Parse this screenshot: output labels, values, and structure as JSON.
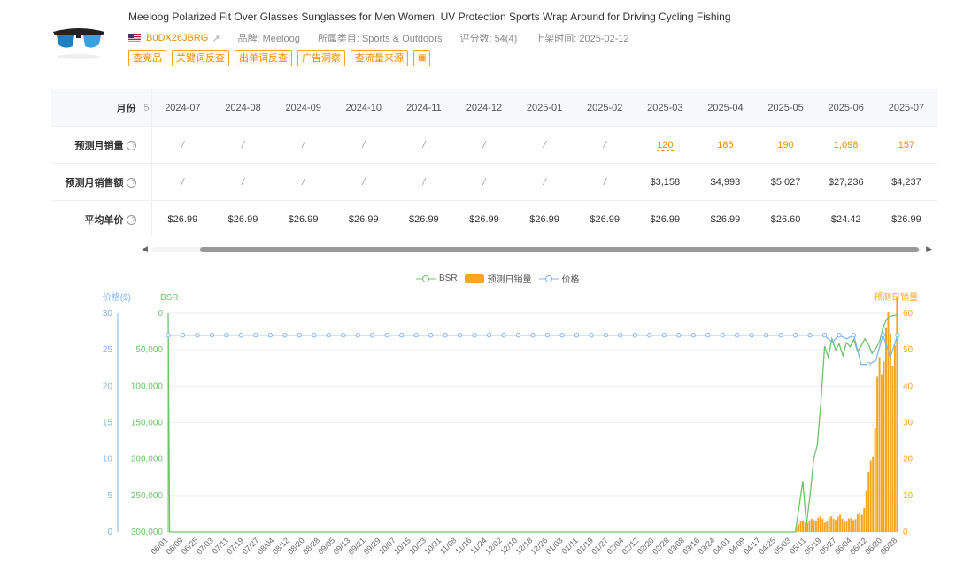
{
  "product": {
    "title": "Meeloog Polarized Fit Over Glasses Sunglasses for Men Women, UV Protection Sports Wrap Around for Driving Cycling Fishing",
    "asin": "B0DX26JBRG",
    "brand": "品牌: Meeloog",
    "category": "所属类目: Sports & Outdoors",
    "rating_count": "评分数: 54(4)",
    "launch_date": "上架时间: 2025-02-12",
    "flag_icon": "us-flag-icon",
    "link_icon": "external-link-icon"
  },
  "tags": [
    "查竞品",
    "关键词反查",
    "出单词反查",
    "广告洞察",
    "查流量来源"
  ],
  "table": {
    "row_month_label": "月份",
    "partial_sep": "5",
    "months": [
      "2024-07",
      "2024-08",
      "2024-09",
      "2024-10",
      "2024-11",
      "2024-12",
      "2025-01",
      "2025-02",
      "2025-03",
      "2025-04",
      "2025-05",
      "2025-06",
      "2025-07"
    ],
    "rows": [
      {
        "label": "预测月销量",
        "values": [
          "/",
          "/",
          "/",
          "/",
          "/",
          "/",
          "/",
          "/",
          "120",
          "185",
          "190",
          "1,098",
          "157"
        ]
      },
      {
        "label": "预测月销售额",
        "values": [
          "/",
          "/",
          "/",
          "/",
          "/",
          "/",
          "/",
          "/",
          "$3,158",
          "$4,993",
          "$5,027",
          "$27,236",
          "$4,237"
        ]
      },
      {
        "label": "平均单价",
        "values": [
          "$26.99",
          "$26.99",
          "$26.99",
          "$26.99",
          "$26.99",
          "$26.99",
          "$26.99",
          "$26.99",
          "$26.99",
          "$26.99",
          "$26.60",
          "$24.42",
          "$26.99"
        ]
      }
    ]
  },
  "legend": {
    "bsr": "BSR",
    "sales": "预测日销量",
    "price": "价格"
  },
  "colors": {
    "bsr": "#6cc46a",
    "sales": "#f6a623",
    "price": "#7eb6f2",
    "accent": "#f08c00"
  },
  "chart_data": {
    "type": "line",
    "axes": {
      "left_price_label": "价格($)",
      "left_price_ticks": [
        "30",
        "25",
        "20",
        "15",
        "10",
        "5",
        "0"
      ],
      "left_bsr_label": "BSR",
      "left_bsr_ticks": [
        "0",
        "50,000",
        "100,000",
        "150,000",
        "200,000",
        "250,000",
        "300,000"
      ],
      "right_sales_label": "预测日销量",
      "right_sales_ticks": [
        "60",
        "50",
        "40",
        "30",
        "20",
        "10",
        "0"
      ],
      "price_range": [
        0,
        30
      ],
      "bsr_range": [
        0,
        300000
      ],
      "sales_range": [
        0,
        60
      ]
    },
    "x_tick_labels": [
      "2024/06/01",
      "2024/06/09",
      "2024/06/25",
      "2024/07/03",
      "2024/07/11",
      "2024/07/19",
      "2024/07/27",
      "2024/08/04",
      "2024/08/12",
      "2024/08/20",
      "2024/08/28",
      "2024/09/05",
      "2024/09/13",
      "2024/09/21",
      "2024/09/29",
      "2024/10/07",
      "2024/10/15",
      "2024/10/23",
      "2024/10/31",
      "2024/11/08",
      "2024/11/16",
      "2024/11/24",
      "2024/12/02",
      "2024/12/10",
      "2024/12/18",
      "2024/12/26",
      "2025/01/03",
      "2025/01/11",
      "2025/01/19",
      "2025/01/27",
      "2025/02/04",
      "2025/02/12",
      "2025/02/20",
      "2025/02/28",
      "2025/03/08",
      "2025/03/16",
      "2025/03/24",
      "2025/04/01",
      "2025/04/09",
      "2025/04/17",
      "2025/04/25",
      "2025/05/03",
      "2025/05/11",
      "2025/05/19",
      "2025/05/27",
      "2025/06/04",
      "2025/06/12",
      "2025/06/20",
      "2025/06/28"
    ],
    "series": [
      {
        "name": "价格",
        "axis": "price",
        "points": [
          [
            0,
            27
          ],
          [
            100,
            27
          ],
          [
            90,
            27
          ],
          [
            91,
            26
          ],
          [
            92,
            27
          ],
          [
            93,
            26.5
          ],
          [
            94,
            27
          ],
          [
            95,
            23
          ],
          [
            96,
            23
          ],
          [
            97,
            23.5
          ],
          [
            98,
            27
          ],
          [
            99,
            24
          ],
          [
            100,
            27
          ]
        ]
      },
      {
        "name": "BSR",
        "axis": "bsr",
        "points": [
          [
            0,
            0
          ],
          [
            0.2,
            300000
          ],
          [
            86,
            300000
          ],
          [
            87,
            230000
          ],
          [
            87.5,
            290000
          ],
          [
            88,
            250000
          ],
          [
            88.5,
            200000
          ],
          [
            89,
            180000
          ],
          [
            89.5,
            120000
          ],
          [
            90,
            45000
          ],
          [
            90.5,
            60000
          ],
          [
            91,
            35000
          ],
          [
            91.5,
            50000
          ],
          [
            92,
            42000
          ],
          [
            92.5,
            58000
          ],
          [
            93,
            40000
          ],
          [
            93.5,
            46000
          ],
          [
            94,
            36000
          ],
          [
            94.5,
            52000
          ],
          [
            95,
            45000
          ],
          [
            95.5,
            35000
          ],
          [
            96,
            42000
          ],
          [
            96.5,
            55000
          ],
          [
            97,
            48000
          ],
          [
            97.5,
            40000
          ],
          [
            98,
            20000
          ],
          [
            98.5,
            8000
          ],
          [
            99,
            4000
          ],
          [
            99.5,
            3000
          ],
          [
            100,
            2000
          ]
        ]
      },
      {
        "name": "预测日销量",
        "axis": "sales",
        "points": [
          [
            86,
            2
          ],
          [
            87,
            3
          ],
          [
            88,
            3
          ],
          [
            89,
            4
          ],
          [
            90,
            3
          ],
          [
            91,
            4
          ],
          [
            92,
            4
          ],
          [
            93,
            3
          ],
          [
            94,
            4
          ],
          [
            95,
            5
          ],
          [
            96,
            15
          ],
          [
            96.5,
            25
          ],
          [
            97,
            35
          ],
          [
            97.5,
            45
          ],
          [
            98,
            55
          ],
          [
            98.5,
            50
          ],
          [
            99,
            58
          ],
          [
            99.5,
            52
          ],
          [
            100,
            57
          ]
        ]
      }
    ]
  }
}
